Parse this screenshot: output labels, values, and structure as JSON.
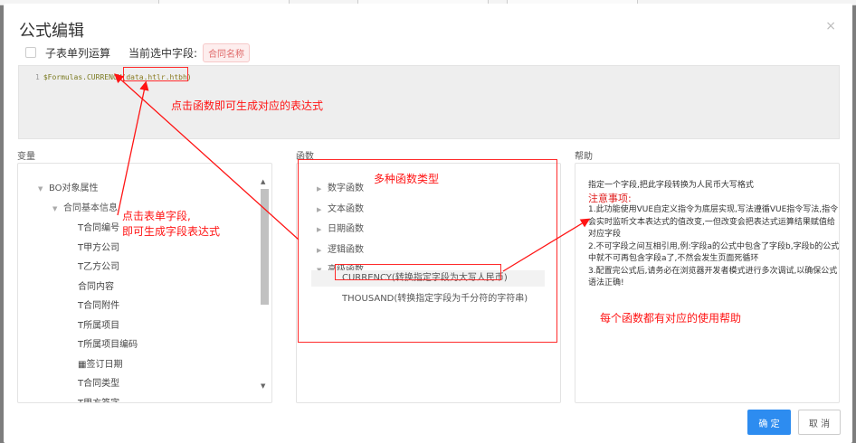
{
  "dialog": {
    "title": "公式编辑",
    "close_symbol": "×",
    "single_column_label": "子表单列运算",
    "selected_field_label": "当前选中字段:",
    "selected_field_value": "合同名称"
  },
  "editor": {
    "line_number": "1",
    "code_function": "$Formulas.CURRENCY(",
    "code_argument": "data.htlr.htbh",
    "code_close": ")"
  },
  "variables": {
    "heading": "变量",
    "root": "BO对象属性",
    "group": "合同基本信息",
    "fields": [
      "合同编号",
      "甲方公司",
      "乙方公司",
      "合同内容",
      "合同附件",
      "所属项目",
      "所属项目编码",
      "签订日期",
      "合同类型",
      "甲方签字"
    ],
    "field_type_glyphs": [
      "T",
      "T",
      "T",
      "",
      "T",
      "T",
      "T",
      "▦",
      "T",
      "T"
    ]
  },
  "functions": {
    "heading": "函数",
    "categories": [
      "数字函数",
      "文本函数",
      "日期函数",
      "逻辑函数",
      "高级函数"
    ],
    "advanced_items": [
      "CURRENCY(转换指定字段为大写人民币)",
      "THOUSAND(转换指定字段为千分符的字符串)"
    ]
  },
  "help": {
    "heading": "帮助",
    "description": "指定一个字段,把此字段转换为人民币大写格式",
    "notice_title": "注意事项:",
    "note1": "1.此功能使用VUE自定义指令为底层实现,写法遵循VUE指令写法,指令会实时监听文本表达式的值改变,一但改变会把表达式运算结果赋值给对应字段",
    "note2": "2.不可字段之间互相引用,例:字段a的公式中包含了字段b,字段b的公式中就不可再包含字段a了,不然会发生页面死循环",
    "note3": "3.配置完公式后,请务必在浏览器开发者模式进行多次调试,以确保公式语法正确!"
  },
  "buttons": {
    "confirm": "确 定",
    "cancel": "取 消"
  },
  "annotations": {
    "click_function": "点击函数即可生成对应的表达式",
    "click_field_line1": "点击表单字段,",
    "click_field_line2": "即可生成字段表达式",
    "function_types": "多种函数类型",
    "help_note": "每个函数都有对应的使用帮助"
  },
  "colors": {
    "primary": "#2d8cf0",
    "annotation_red": "#ff1414",
    "notice_red": "#e02020"
  }
}
